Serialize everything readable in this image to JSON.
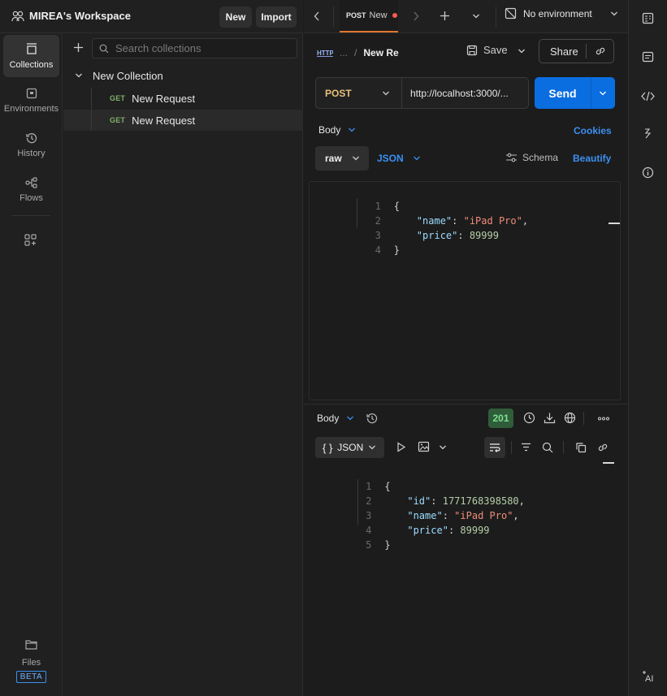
{
  "workspace": {
    "name": "MIREA's Workspace",
    "new_label": "New",
    "import_label": "Import"
  },
  "rail": {
    "items": [
      {
        "label": "Collections"
      },
      {
        "label": "Environments"
      },
      {
        "label": "History"
      },
      {
        "label": "Flows"
      }
    ],
    "files_label": "Files",
    "beta_label": "BETA"
  },
  "collections": {
    "search_placeholder": "Search collections",
    "collection_name": "New Collection",
    "requests": [
      {
        "method": "GET",
        "name": "New Request"
      },
      {
        "method": "GET",
        "name": "New Request"
      }
    ]
  },
  "tabs": {
    "active_method": "POST",
    "active_name": "New",
    "environment": "No environment"
  },
  "request": {
    "breadcrumb_prefix": "...",
    "title": "New Re",
    "save_label": "Save",
    "share_label": "Share",
    "method": "POST",
    "url": "http://localhost:3000/...",
    "send_label": "Send",
    "body_tab": "Body",
    "cookies_label": "Cookies",
    "raw_label": "raw",
    "json_label": "JSON",
    "schema_label": "Schema",
    "beautify_label": "Beautify",
    "body_lines": [
      {
        "n": "1",
        "text": "{"
      },
      {
        "n": "2",
        "key": "\"name\"",
        "value": "\"iPad Pro\"",
        "type": "str",
        "comma": ","
      },
      {
        "n": "3",
        "key": "\"price\"",
        "value": "89999",
        "type": "num",
        "comma": ""
      },
      {
        "n": "4",
        "text": "}"
      }
    ]
  },
  "response": {
    "body_tab": "Body",
    "status": "201",
    "format": "JSON",
    "lines": [
      {
        "n": "1",
        "text": "{"
      },
      {
        "n": "2",
        "key": "\"id\"",
        "value": "1771768398580",
        "type": "num",
        "comma": ","
      },
      {
        "n": "3",
        "key": "\"name\"",
        "value": "\"iPad Pro\"",
        "type": "str",
        "comma": ","
      },
      {
        "n": "4",
        "key": "\"price\"",
        "value": "89999",
        "type": "num",
        "comma": ""
      },
      {
        "n": "5",
        "text": "}"
      }
    ]
  },
  "colors": {
    "accent_blue": "#0b6ee0",
    "status_green": "#2f5d3a",
    "get_green": "#7fb069",
    "post_orange": "#e0a04a"
  }
}
